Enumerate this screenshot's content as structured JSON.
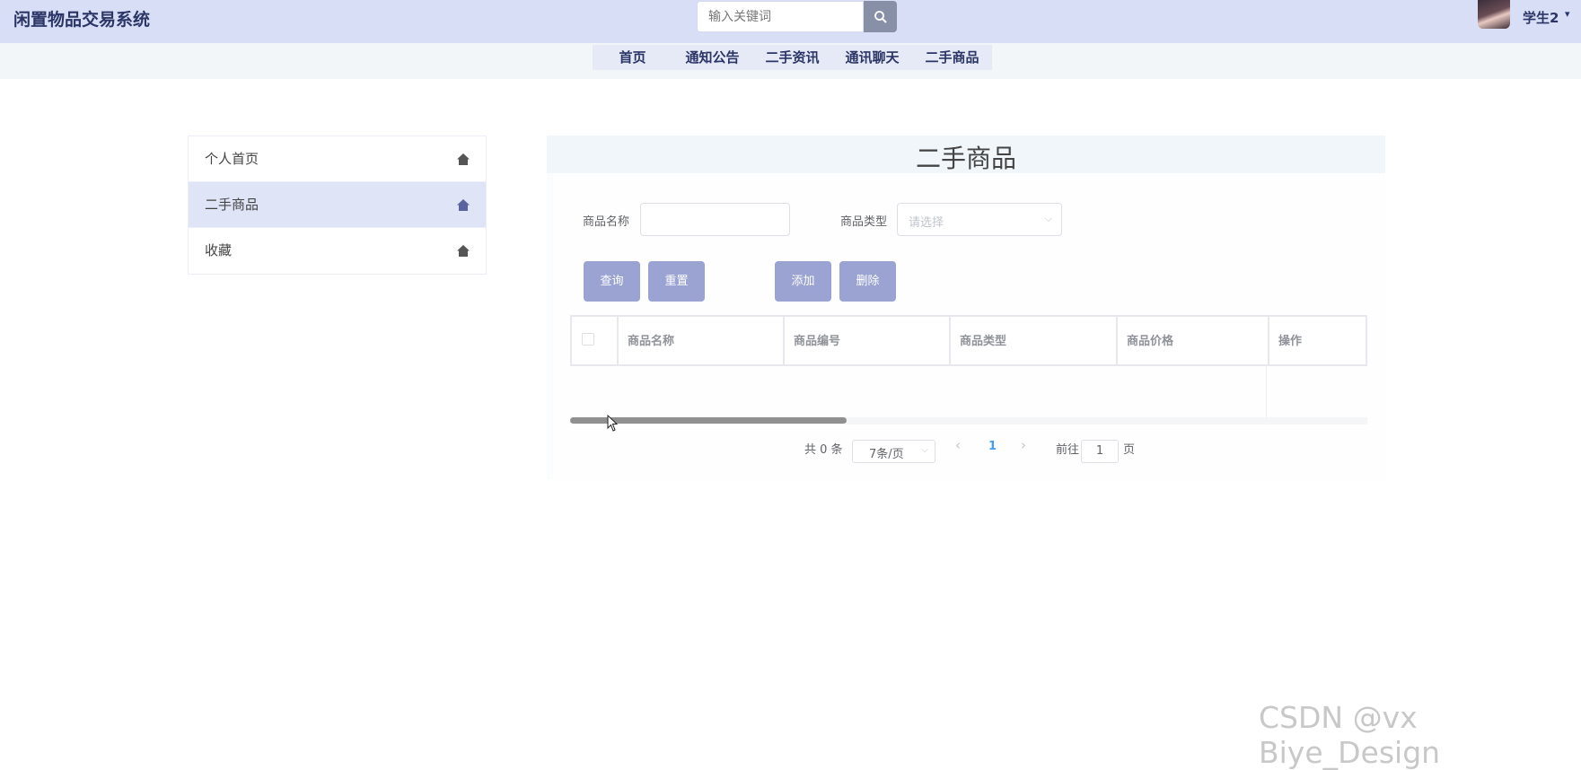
{
  "header": {
    "app_title": "闲置物品交易系统",
    "search_placeholder": "输入关键词",
    "user_name": "学生2",
    "user_caret": "▾"
  },
  "nav": {
    "items": [
      {
        "label": "首页"
      },
      {
        "label": "通知公告"
      },
      {
        "label": "二手资讯"
      },
      {
        "label": "通讯聊天"
      },
      {
        "label": "二手商品"
      }
    ]
  },
  "sidebar": {
    "items": [
      {
        "label": "个人首页",
        "active": false
      },
      {
        "label": "二手商品",
        "active": true
      },
      {
        "label": "收藏",
        "active": false
      }
    ]
  },
  "main": {
    "title": "二手商品",
    "filters": {
      "name_label": "商品名称",
      "name_value": "",
      "type_label": "商品类型",
      "type_placeholder": "请选择"
    },
    "buttons": {
      "query": "查询",
      "reset": "重置",
      "add": "添加",
      "delete": "删除"
    },
    "table": {
      "columns": [
        "商品名称",
        "商品编号",
        "商品类型",
        "商品价格",
        "操作"
      ],
      "rows": []
    },
    "pagination": {
      "total": "共 0 条",
      "page_size": "7条/页",
      "prev": "‹",
      "current_page": "1",
      "next": "›",
      "goto_prefix": "前往",
      "goto_value": "1",
      "goto_suffix": "页"
    }
  },
  "watermark": "CSDN @vx Biye_Design",
  "colors": {
    "header_bg": "#d7def5",
    "accent_button": "#9aa3d1",
    "active_sidebar": "#dfe4f7",
    "current_page": "#409eff"
  }
}
